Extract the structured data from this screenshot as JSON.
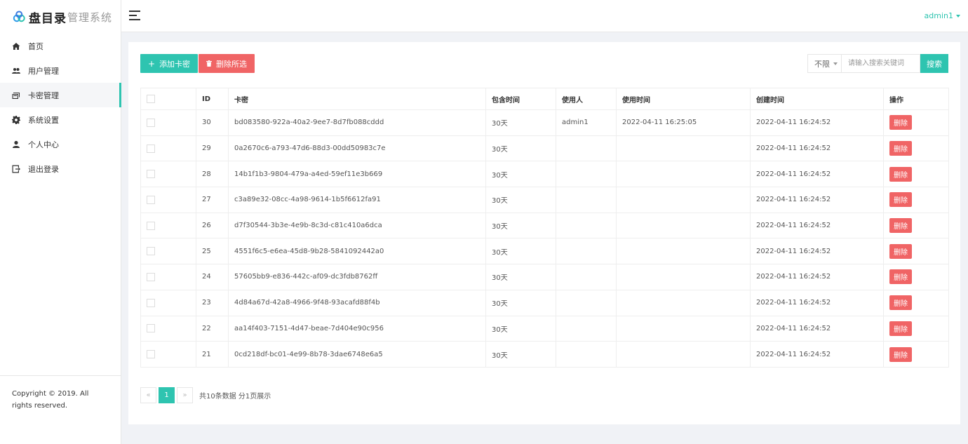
{
  "brand": {
    "main": "盘目录",
    "sub": "管理系统"
  },
  "sidebar": {
    "items": [
      {
        "label": "首页",
        "icon": "home-icon"
      },
      {
        "label": "用户管理",
        "icon": "users-icon"
      },
      {
        "label": "卡密管理",
        "icon": "card-icon",
        "active": true
      },
      {
        "label": "系统设置",
        "icon": "gear-icon"
      },
      {
        "label": "个人中心",
        "icon": "user-icon"
      },
      {
        "label": "退出登录",
        "icon": "logout-icon"
      }
    ],
    "footer": "Copyright © 2019. All rights reserved."
  },
  "header": {
    "user": "admin1"
  },
  "toolbar": {
    "add_label": "添加卡密",
    "delete_selected_label": "删除所选",
    "filter_value": "不限",
    "search_placeholder": "请输入搜索关键词",
    "search_label": "搜索"
  },
  "table": {
    "columns": [
      "ID",
      "卡密",
      "包含时间",
      "使用人",
      "使用时间",
      "创建时间",
      "操作"
    ],
    "delete_label": "删除",
    "rows": [
      {
        "id": "30",
        "key": "bd083580-922a-40a2-9ee7-8d7fb088cddd",
        "duration": "30天",
        "user": "admin1",
        "used_at": "2022-04-11 16:25:05",
        "created_at": "2022-04-11 16:24:52"
      },
      {
        "id": "29",
        "key": "0a2670c6-a793-47d6-88d3-00dd50983c7e",
        "duration": "30天",
        "user": "",
        "used_at": "",
        "created_at": "2022-04-11 16:24:52"
      },
      {
        "id": "28",
        "key": "14b1f1b3-9804-479a-a4ed-59ef11e3b669",
        "duration": "30天",
        "user": "",
        "used_at": "",
        "created_at": "2022-04-11 16:24:52"
      },
      {
        "id": "27",
        "key": "c3a89e32-08cc-4a98-9614-1b5f6612fa91",
        "duration": "30天",
        "user": "",
        "used_at": "",
        "created_at": "2022-04-11 16:24:52"
      },
      {
        "id": "26",
        "key": "d7f30544-3b3e-4e9b-8c3d-c81c410a6dca",
        "duration": "30天",
        "user": "",
        "used_at": "",
        "created_at": "2022-04-11 16:24:52"
      },
      {
        "id": "25",
        "key": "4551f6c5-e6ea-45d8-9b28-5841092442a0",
        "duration": "30天",
        "user": "",
        "used_at": "",
        "created_at": "2022-04-11 16:24:52"
      },
      {
        "id": "24",
        "key": "57605bb9-e836-442c-af09-dc3fdb8762ff",
        "duration": "30天",
        "user": "",
        "used_at": "",
        "created_at": "2022-04-11 16:24:52"
      },
      {
        "id": "23",
        "key": "4d84a67d-42a8-4966-9f48-93acafd88f4b",
        "duration": "30天",
        "user": "",
        "used_at": "",
        "created_at": "2022-04-11 16:24:52"
      },
      {
        "id": "22",
        "key": "aa14f403-7151-4d47-beae-7d404e90c956",
        "duration": "30天",
        "user": "",
        "used_at": "",
        "created_at": "2022-04-11 16:24:52"
      },
      {
        "id": "21",
        "key": "0cd218df-bc01-4e99-8b78-3dae6748e6a5",
        "duration": "30天",
        "user": "",
        "used_at": "",
        "created_at": "2022-04-11 16:24:52"
      }
    ]
  },
  "pagination": {
    "prev": "«",
    "current": "1",
    "next": "»",
    "info": "共10条数据 分1页展示"
  },
  "colors": {
    "accent": "#2ec4b0",
    "danger": "#f06465"
  }
}
